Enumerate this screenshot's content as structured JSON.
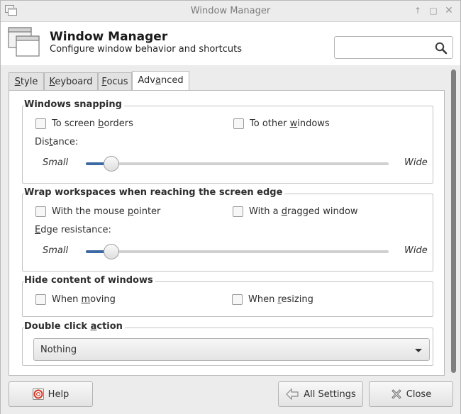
{
  "window": {
    "title": "Window Manager"
  },
  "header": {
    "title": "Window Manager",
    "subtitle": "Configure window behavior and shortcuts",
    "search_placeholder": ""
  },
  "tabs": [
    {
      "pre": "",
      "key": "S",
      "post": "tyle"
    },
    {
      "pre": "",
      "key": "K",
      "post": "eyboard"
    },
    {
      "pre": "",
      "key": "F",
      "post": "ocus"
    },
    {
      "pre": "Adv",
      "key": "a",
      "post": "nced"
    }
  ],
  "snapping": {
    "legend": "Windows snapping",
    "screen_borders": {
      "pre": "To screen ",
      "key": "b",
      "post": "orders",
      "checked": false
    },
    "other_windows": {
      "pre": "To other ",
      "key": "w",
      "post": "indows",
      "checked": false
    },
    "distance": {
      "pre": "Dis",
      "key": "t",
      "post": "ance:"
    },
    "small": "Small",
    "wide": "Wide",
    "value": 0.05
  },
  "wrap": {
    "legend": "Wrap workspaces when reaching the screen edge",
    "mouse_pointer": {
      "pre": "With the mouse ",
      "key": "p",
      "post": "ointer",
      "checked": false
    },
    "dragged_window": {
      "pre": "With a ",
      "key": "d",
      "post": "ragged window",
      "checked": false
    },
    "edge": {
      "pre": "",
      "key": "E",
      "post": "dge resistance:"
    },
    "small": "Small",
    "wide": "Wide",
    "value": 0.05
  },
  "hide": {
    "legend": "Hide content of windows",
    "moving": {
      "pre": "When ",
      "key": "m",
      "post": "oving",
      "checked": false
    },
    "resizing": {
      "pre": "When ",
      "key": "r",
      "post": "esizing",
      "checked": false
    }
  },
  "dblclick": {
    "legend_pre": "Double click ",
    "legend_key": "a",
    "legend_post": "ction",
    "selected": "Nothing"
  },
  "footer": {
    "help": "Help",
    "all_settings": "All Settings",
    "close": "Close"
  }
}
